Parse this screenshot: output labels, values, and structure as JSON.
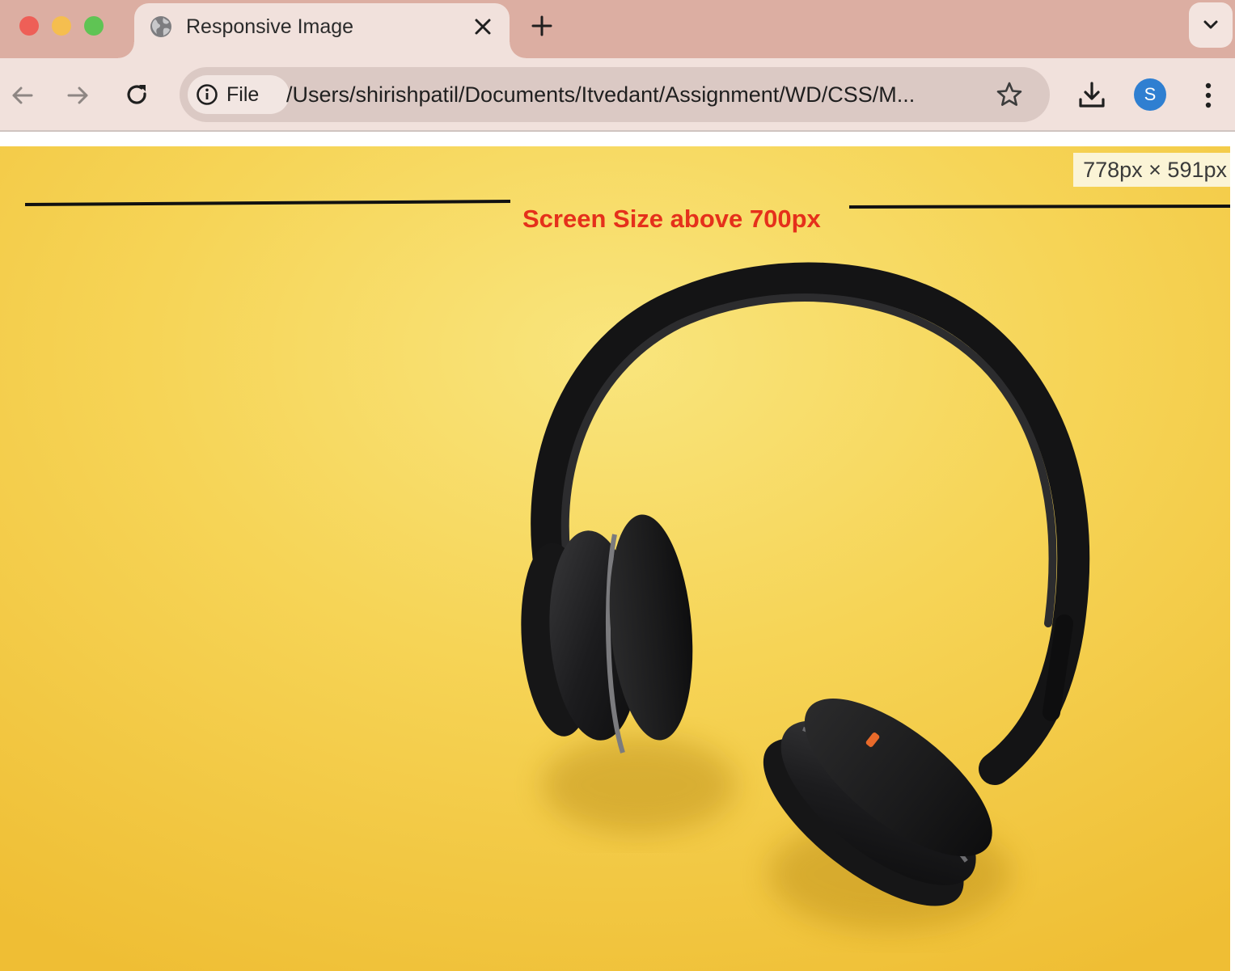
{
  "tab": {
    "title": "Responsive Image",
    "close_label": "×",
    "favicon": "globe-icon"
  },
  "toolbar": {
    "back_icon": "back-arrow-icon",
    "forward_icon": "forward-arrow-icon",
    "reload_icon": "reload-icon",
    "site_info_label": "File",
    "url": "/Users/shirishpatil/Documents/Itvedant/Assignment/WD/CSS/M...",
    "bookmark_icon": "star-icon",
    "download_icon": "download-icon",
    "profile_initial": "S",
    "menu_icon": "kebab-menu-icon"
  },
  "page": {
    "viewport_size": "778px × 591px",
    "heading": "Screen Size above 700px",
    "image_subject": "headphones-photo"
  },
  "colors": {
    "tabstrip": "#dcaea2",
    "toolbar": "#f1e1dc",
    "heading": "#e5301b",
    "avatar": "#2f7fd1",
    "photo_background": "#f4c93a"
  }
}
